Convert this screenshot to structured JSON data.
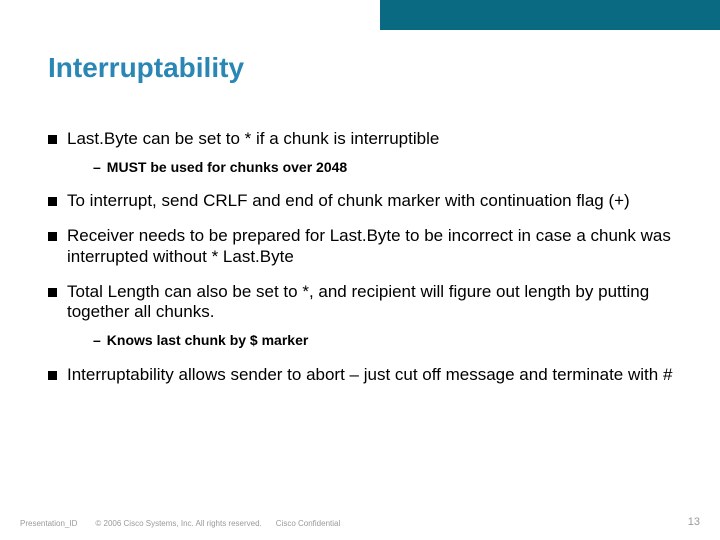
{
  "title": "Interruptability",
  "bullets": [
    {
      "text": "Last.Byte can be set to * if a chunk is interruptible",
      "sub": [
        {
          "text": "MUST be used for chunks over 2048"
        }
      ]
    },
    {
      "text": "To interrupt, send CRLF and end of chunk marker with continuation flag (+)",
      "sub": []
    },
    {
      "text": "Receiver needs to be prepared for Last.Byte to be incorrect in case a chunk was interrupted without * Last.Byte",
      "sub": []
    },
    {
      "text": "Total Length can also be set to *, and recipient will figure out length by putting together all chunks.",
      "sub": [
        {
          "text": "Knows last chunk by $ marker"
        }
      ]
    },
    {
      "text": "Interruptability allows sender to abort – just cut off message and terminate with #",
      "sub": []
    }
  ],
  "footer": {
    "presentation_id": "Presentation_ID",
    "copyright": "© 2006 Cisco Systems, Inc. All rights reserved.",
    "confidential": "Cisco Confidential",
    "page_number": "13"
  }
}
